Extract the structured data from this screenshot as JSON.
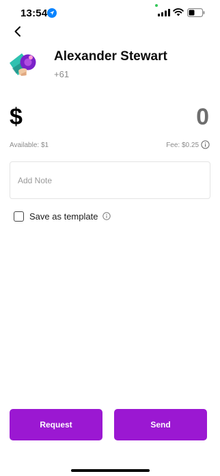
{
  "status_bar": {
    "time": "13:54"
  },
  "contact": {
    "name": "Alexander Stewart",
    "phone": "+61"
  },
  "amount": {
    "currency_symbol": "$",
    "value": "0",
    "available": "Available: $1",
    "fee": "Fee: $0.25"
  },
  "note": {
    "placeholder": "Add Note"
  },
  "template": {
    "label": "Save as template",
    "checked": false
  },
  "actions": {
    "request_label": "Request",
    "send_label": "Send"
  },
  "colors": {
    "accent": "#9b18d2",
    "location_blue": "#0a84ff",
    "signal_green": "#34c759"
  },
  "icons": {
    "back": "chevron-left-icon",
    "location": "location-arrow-icon",
    "fee_info": "info-icon",
    "template_info": "info-icon"
  }
}
